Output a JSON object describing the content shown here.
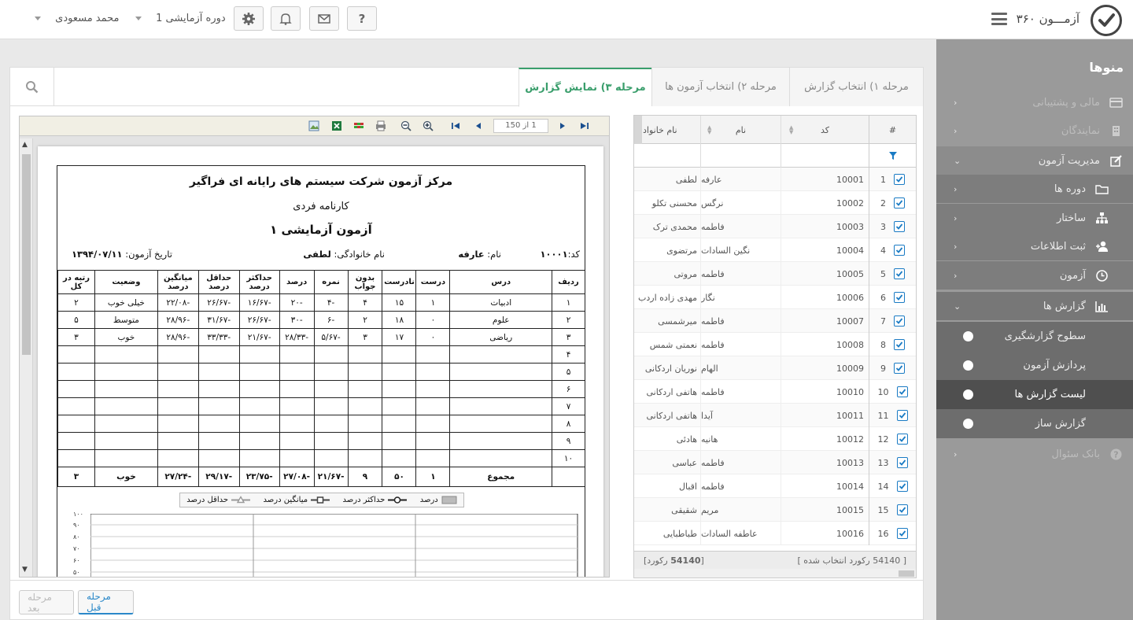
{
  "header": {
    "app_title": "آزمـــون ۳۶۰",
    "user_name": "محمد مسعودی",
    "period_select": "دوره آزمایشی 1",
    "help_label": "?"
  },
  "sidebar": {
    "title": "منوها",
    "items": [
      {
        "label": "مالی و پشتیبانی",
        "icon": "card-icon"
      },
      {
        "label": "نمایندگان",
        "icon": "building-icon"
      },
      {
        "label": "مدیریت آزمون",
        "icon": "edit-icon"
      },
      {
        "label": "دوره ها",
        "icon": "folder-icon"
      },
      {
        "label": "ساختار",
        "icon": "sitemap-icon"
      },
      {
        "label": "ثبت اطلاعات",
        "icon": "user-plus-icon"
      },
      {
        "label": "آزمون",
        "icon": "clock-icon"
      },
      {
        "label": "گزارش ها",
        "icon": "bar-chart-icon"
      },
      {
        "label": "سطوح گزارشگیری"
      },
      {
        "label": "پردازش آزمون"
      },
      {
        "label": "لیست گزارش ها"
      },
      {
        "label": "گزارش ساز"
      },
      {
        "label": "بانک سئوال",
        "icon": "question-icon"
      }
    ]
  },
  "tabs": [
    {
      "label": "مرحله ۱) انتخاب گزارش"
    },
    {
      "label": "مرحله ۲) انتخاب آزمون ها"
    },
    {
      "label": "مرحله ۳) نمایش گزارش"
    }
  ],
  "grid": {
    "headers": {
      "num": "#",
      "code": "کد",
      "first": "نام",
      "last": "نام خانواد"
    },
    "rows": [
      {
        "n": "1",
        "code": "10001",
        "first": "عارفه",
        "last": "لطفی"
      },
      {
        "n": "2",
        "code": "10002",
        "first": "نرگس",
        "last": "محسنی تکلو"
      },
      {
        "n": "3",
        "code": "10003",
        "first": "فاطمه",
        "last": "محمدی ترک"
      },
      {
        "n": "4",
        "code": "10004",
        "first": "نگین السادات",
        "last": "مرتضوی"
      },
      {
        "n": "5",
        "code": "10005",
        "first": "فاطمه",
        "last": "مروتی"
      },
      {
        "n": "6",
        "code": "10006",
        "first": "نگار",
        "last": "مهدی زاده اردب"
      },
      {
        "n": "7",
        "code": "10007",
        "first": "فاطمه",
        "last": "میرشمسی"
      },
      {
        "n": "8",
        "code": "10008",
        "first": "فاطمه",
        "last": "نعمتی شمس"
      },
      {
        "n": "9",
        "code": "10009",
        "first": "الهام",
        "last": "نوریان اردکانی"
      },
      {
        "n": "10",
        "code": "10010",
        "first": "فاطمه",
        "last": "هاتفی اردکانی"
      },
      {
        "n": "11",
        "code": "10011",
        "first": "آیدا",
        "last": "هاتفی اردکانی"
      },
      {
        "n": "12",
        "code": "10012",
        "first": "هانیه",
        "last": "هادئی"
      },
      {
        "n": "13",
        "code": "10013",
        "first": "فاطمه",
        "last": "عباسی"
      },
      {
        "n": "14",
        "code": "10014",
        "first": "فاطمه",
        "last": "اقبال"
      },
      {
        "n": "15",
        "code": "10015",
        "first": "مریم",
        "last": "شقیقی"
      },
      {
        "n": "16",
        "code": "10016",
        "first": "عاطفه السادات",
        "last": "طباطبایی"
      }
    ],
    "footer_selected": "[ 54140 رکورد انتخاب شده ]",
    "footer_total_num": "54140",
    "footer_total_unit": "رکورد]",
    "footer_total_open": "["
  },
  "viewer": {
    "page_indicator": "1 از 150"
  },
  "report": {
    "org": "مرکز آزمون شرکت سیستم های رایانه ای فراگیر",
    "subtitle": "کارنامه فردی",
    "exam": "آزمون آزمایشی ۱",
    "code_label": "کد:",
    "code_value": "۱۰۰۰۱",
    "name_label": "نام:",
    "name_value": "عارفه",
    "family_label": "نام خانوادگی:",
    "family_value": "لطفی",
    "date_label": "تاریخ آزمون:",
    "date_value": "۱۳۹۴/۰۷/۱۱",
    "headers": [
      "ردیف",
      "درس",
      "درست",
      "نادرست",
      "بدون جواب",
      "نمره",
      "درصد",
      "حداکثر درصد",
      "حداقل درصد",
      "میانگین درصد",
      "وضعیت",
      "رتبه در کل"
    ],
    "rows": [
      [
        "۱",
        "ادبیات",
        "۱",
        "۱۵",
        "۴",
        "-۴",
        "-۲۰",
        "-۱۶/۶۷",
        "-۲۶/۶۷",
        "-۲۲/۰۸",
        "خیلی خوب",
        "۲"
      ],
      [
        "۲",
        "علوم",
        "۰",
        "۱۸",
        "۲",
        "-۶",
        "-۳۰",
        "-۲۶/۶۷",
        "-۳۱/۶۷",
        "-۲۸/۹۶",
        "متوسط",
        "۵"
      ],
      [
        "۳",
        "ریاضی",
        "۰",
        "۱۷",
        "۳",
        "-۵/۶۷",
        "-۲۸/۳۳",
        "-۲۱/۶۷",
        "-۳۳/۳۳",
        "-۲۸/۹۶",
        "خوب",
        "۳"
      ],
      [
        "۴",
        "",
        "",
        "",
        "",
        "",
        "",
        "",
        "",
        "",
        "",
        ""
      ],
      [
        "۵",
        "",
        "",
        "",
        "",
        "",
        "",
        "",
        "",
        "",
        "",
        ""
      ],
      [
        "۶",
        "",
        "",
        "",
        "",
        "",
        "",
        "",
        "",
        "",
        "",
        ""
      ],
      [
        "۷",
        "",
        "",
        "",
        "",
        "",
        "",
        "",
        "",
        "",
        "",
        ""
      ],
      [
        "۸",
        "",
        "",
        "",
        "",
        "",
        "",
        "",
        "",
        "",
        "",
        ""
      ],
      [
        "۹",
        "",
        "",
        "",
        "",
        "",
        "",
        "",
        "",
        "",
        "",
        ""
      ],
      [
        "۱۰",
        "",
        "",
        "",
        "",
        "",
        "",
        "",
        "",
        "",
        "",
        ""
      ]
    ],
    "sum_row": [
      "",
      "مجموع",
      "۱",
      "۵۰",
      "۹",
      "-۲۱/۶۷",
      "-۲۷/۰۸",
      "-۲۳/۷۵",
      "-۲۹/۱۷",
      "-۲۷/۲۴",
      "خوب",
      "۳"
    ],
    "legend": [
      "درصد",
      "حداکثر درصد",
      "میانگین درصد",
      "حداقل درصد"
    ],
    "y_ticks": [
      "۱۰۰",
      "۹۰",
      "۸۰",
      "۷۰",
      "۶۰",
      "۵۰"
    ]
  },
  "buttons": {
    "prev": "مرحله قبل",
    "next": "مرحله بعد"
  }
}
